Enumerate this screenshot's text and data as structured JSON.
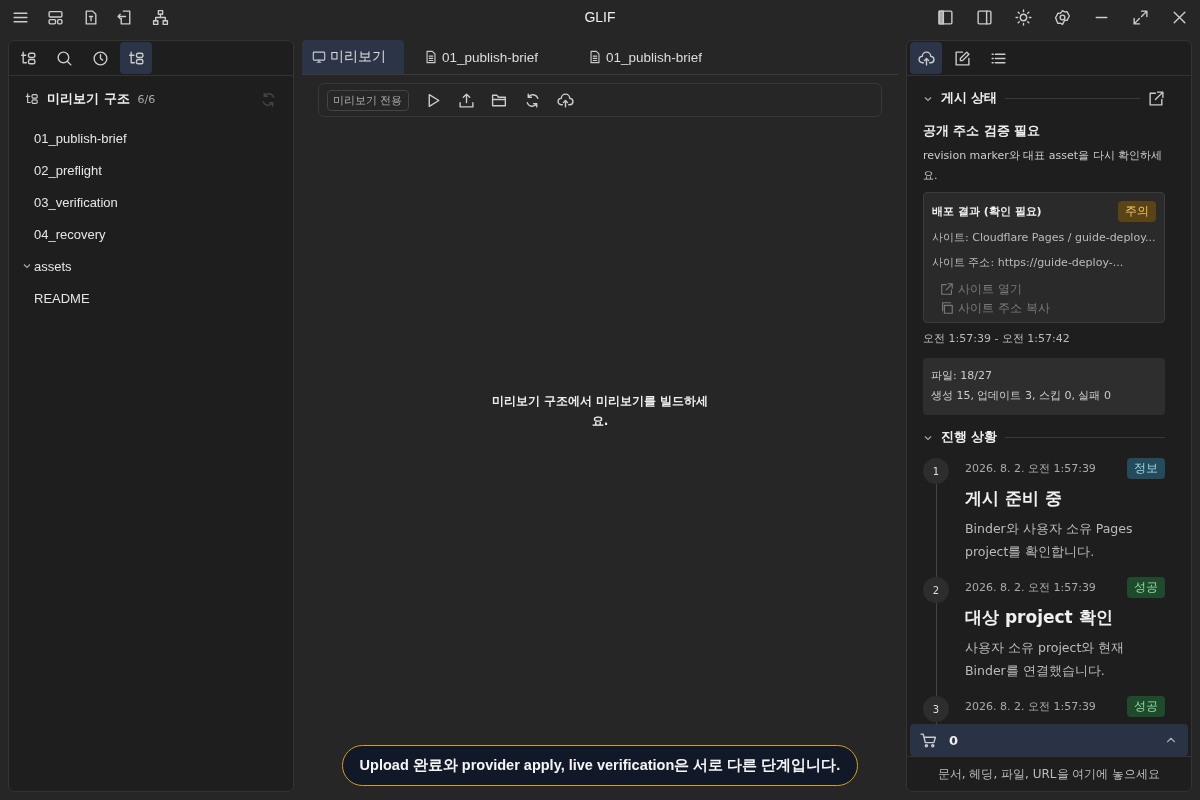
{
  "window": {
    "title": "GLIF"
  },
  "left_tabs": [
    {
      "selected": false
    },
    {
      "selected": false
    },
    {
      "selected": false
    },
    {
      "selected": true
    }
  ],
  "outline": {
    "title": "미리보기 구조",
    "count": "6/6",
    "items": [
      {
        "label": "01_publish-brief"
      },
      {
        "label": "02_preflight"
      },
      {
        "label": "03_verification"
      },
      {
        "label": "04_recovery"
      },
      {
        "label": "assets",
        "expanded": true
      },
      {
        "label": "README"
      }
    ]
  },
  "tabs": [
    {
      "label": "미리보기",
      "selected": true
    },
    {
      "label": "01_publish-brief",
      "selected": false
    },
    {
      "label": "01_publish-brief",
      "selected": false
    }
  ],
  "toolbar": {
    "badge": "미리보기 전용"
  },
  "empty_message": "미리보기 구조에서 미리보기를 빌드하세요.",
  "toast": "Upload 완료와 provider apply, live verification은 서로 다른 단계입니다.",
  "right_tabs": [
    {
      "selected": true
    },
    {
      "selected": false
    },
    {
      "selected": false
    }
  ],
  "publish": {
    "section": "게시 상태",
    "expanded": true,
    "heading": "공개 주소 검증 필요",
    "note": "revision marker와 대표 asset을 다시 확인하세요.",
    "result": {
      "title": "배포 결과 (확인 필요)",
      "badge": {
        "text": "주의",
        "kind": "warning"
      },
      "lines": [
        "사이트: Cloudflare Pages / guide-deploy...",
        "사이트 주소: https://guide-deploy-..."
      ],
      "actions": [
        {
          "label": "사이트 열기",
          "disabled": true
        },
        {
          "label": "사이트 주소 복사",
          "disabled": true
        }
      ]
    },
    "time_range": "오전 1:57:39 - 오전 1:57:42",
    "stats": [
      "파일: 18/27",
      "생성 15, 업데이트 3, 스킵 0, 실패 0"
    ]
  },
  "progress": {
    "section": "진행 상황",
    "expanded": true,
    "steps": [
      {
        "number": "1",
        "time": "2026. 8. 2. 오전 1:57:39",
        "badge": {
          "text": "정보",
          "kind": "info"
        },
        "title": "게시 준비 중",
        "detail": "Binder와 사용자 소유 Pages project를 확인합니다."
      },
      {
        "number": "2",
        "time": "2026. 8. 2. 오전 1:57:39",
        "badge": {
          "text": "성공",
          "kind": "success"
        },
        "title": "대상 project 확인",
        "detail": "사용자 소유 project와 현재 Binder를 연결했습니다."
      },
      {
        "number": "3",
        "time": "2026. 8. 2. 오전 1:57:39",
        "badge": {
          "text": "성공",
          "kind": "success"
        }
      }
    ]
  },
  "cart": {
    "count": "0",
    "expanded": false
  },
  "drop_hint": "문서, 헤딩, 파일, URL을 여기에 놓으세요"
}
